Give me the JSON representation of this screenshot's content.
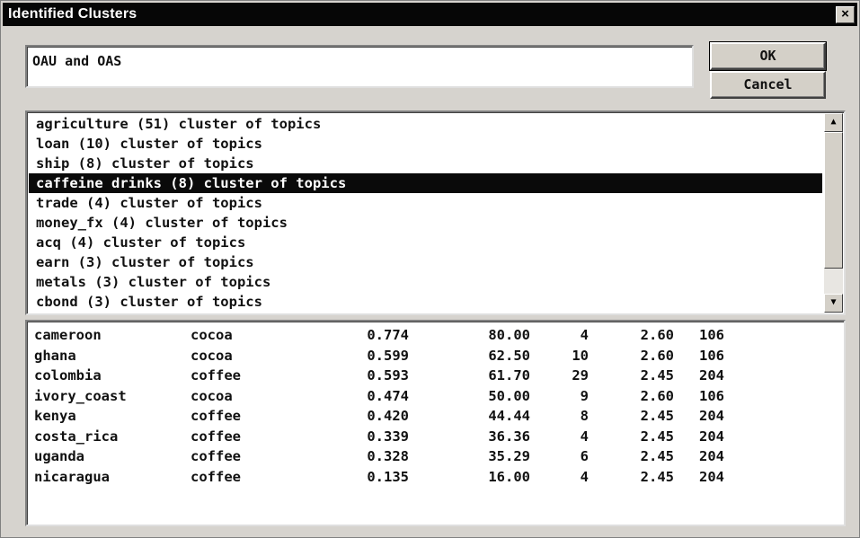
{
  "window": {
    "title": "Identified Clusters",
    "close_label": "×"
  },
  "query": {
    "value": "OAU and OAS"
  },
  "buttons": {
    "ok": "OK",
    "cancel": "Cancel"
  },
  "clusters": {
    "selected_index": 3,
    "items": [
      "agriculture (51) cluster of topics",
      "loan (10) cluster of topics",
      "ship (8) cluster of topics",
      "caffeine drinks (8) cluster of topics",
      "trade (4) cluster of topics",
      "money_fx (4) cluster of topics",
      "acq (4) cluster of topics",
      "earn (3) cluster of topics",
      "metals (3) cluster of topics",
      "cbond (3) cluster of topics"
    ]
  },
  "scrollbar": {
    "up_icon": "▲",
    "down_icon": "▼"
  },
  "details": {
    "rows": [
      [
        "cameroon",
        "cocoa",
        "0.774",
        "80.00",
        "4",
        "2.60",
        "106"
      ],
      [
        "ghana",
        "cocoa",
        "0.599",
        "62.50",
        "10",
        "2.60",
        "106"
      ],
      [
        "colombia",
        "coffee",
        "0.593",
        "61.70",
        "29",
        "2.45",
        "204"
      ],
      [
        "ivory_coast",
        "cocoa",
        "0.474",
        "50.00",
        "9",
        "2.60",
        "106"
      ],
      [
        "kenya",
        "coffee",
        "0.420",
        "44.44",
        "8",
        "2.45",
        "204"
      ],
      [
        "costa_rica",
        "coffee",
        "0.339",
        "36.36",
        "4",
        "2.45",
        "204"
      ],
      [
        "uganda",
        "coffee",
        "0.328",
        "35.29",
        "6",
        "2.45",
        "204"
      ],
      [
        "nicaragua",
        "coffee",
        "0.135",
        "16.00",
        "4",
        "2.45",
        "204"
      ]
    ]
  }
}
